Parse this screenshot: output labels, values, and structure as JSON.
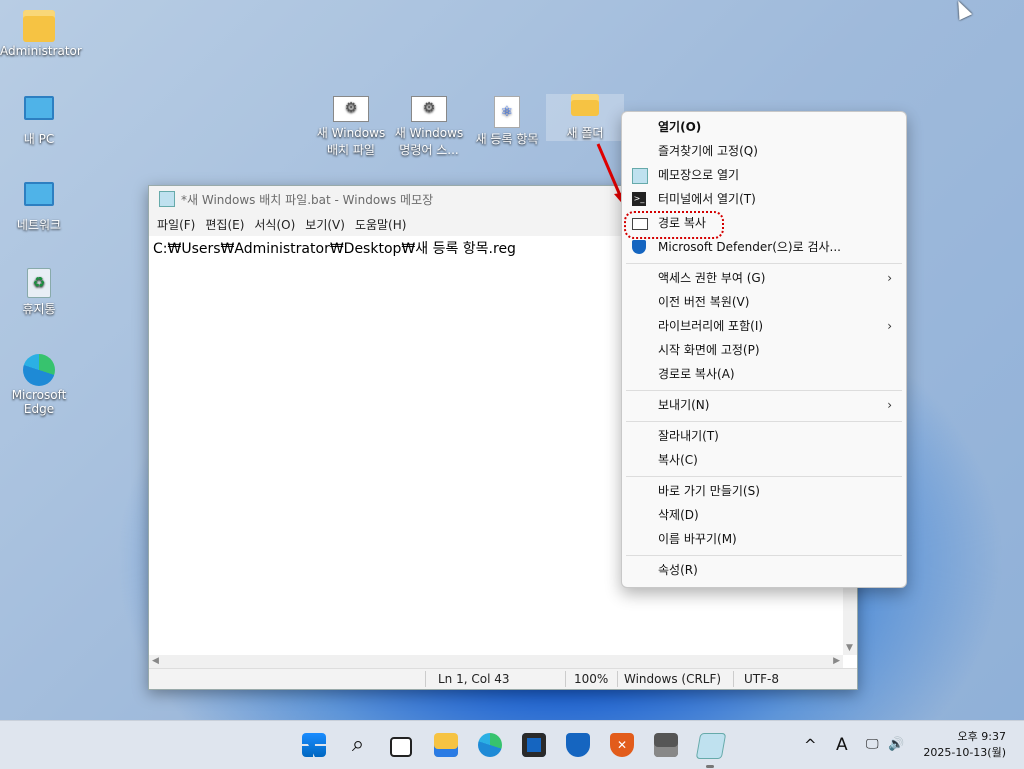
{
  "desktop": {
    "icons": [
      {
        "label": "Administrator",
        "icon": "folder-icon"
      },
      {
        "label": "내 PC",
        "icon": "pc-icon"
      },
      {
        "label": "네트워크",
        "icon": "network-icon"
      },
      {
        "label": "휴지통",
        "icon": "recycle-bin-icon"
      },
      {
        "label": "Microsoft Edge",
        "icon": "edge-icon"
      }
    ],
    "files": [
      {
        "label": "새 Windows 배치 파일",
        "icon": "batch-file-icon"
      },
      {
        "label": "새 Windows 명령어 스...",
        "icon": "cmd-file-icon"
      },
      {
        "label": "새 등록 항목",
        "icon": "reg-file-icon"
      },
      {
        "label": "새 폴더",
        "icon": "folder-icon"
      }
    ]
  },
  "notepad": {
    "title": "*새 Windows 배치 파일.bat - Windows 메모장",
    "menu": [
      "파일(F)",
      "편집(E)",
      "서식(O)",
      "보기(V)",
      "도움말(H)"
    ],
    "content": "C:₩Users₩Administrator₩Desktop₩새 등록 항목.reg",
    "status": {
      "position": "Ln 1, Col 43",
      "zoom": "100%",
      "line_ending": "Windows (CRLF)",
      "encoding": "UTF-8"
    }
  },
  "context_menu": {
    "groups": [
      [
        {
          "label": "열기(O)",
          "bold": true
        },
        {
          "label": "즐겨찾기에 고정(Q)"
        },
        {
          "label": "메모장으로 열기",
          "icon": "notepad-icon"
        },
        {
          "label": "터미널에서 열기(T)",
          "icon": "terminal-icon"
        },
        {
          "label": "경로 복사",
          "icon": "copy-path-icon",
          "highlighted": true
        },
        {
          "label": "Microsoft Defender(으)로 검사...",
          "icon": "defender-shield-icon"
        }
      ],
      [
        {
          "label": "액세스 권한 부여 (G)",
          "submenu": true
        },
        {
          "label": "이전 버전 복원(V)"
        },
        {
          "label": "라이브러리에 포함(I)",
          "submenu": true
        },
        {
          "label": "시작 화면에 고정(P)"
        },
        {
          "label": "경로로 복사(A)"
        }
      ],
      [
        {
          "label": "보내기(N)",
          "submenu": true
        }
      ],
      [
        {
          "label": "잘라내기(T)"
        },
        {
          "label": "복사(C)"
        }
      ],
      [
        {
          "label": "바로 가기 만들기(S)"
        },
        {
          "label": "삭제(D)"
        },
        {
          "label": "이름 바꾸기(M)"
        }
      ],
      [
        {
          "label": "속성(R)"
        }
      ]
    ],
    "submenu_glyph": "›"
  },
  "taskbar": {
    "apps": [
      "start-icon",
      "search-icon",
      "task-view-icon",
      "file-explorer-icon",
      "edge-icon",
      "store-icon",
      "defender-icon",
      "antivirus-icon",
      "printer-icon",
      "notepad-icon"
    ],
    "tray": {
      "chevron": "^",
      "ime": "A",
      "clock_time": "오후 9:37",
      "clock_date": "2025-10-13(월)"
    }
  },
  "colors": {
    "accent": "#0067c0",
    "highlight_border": "#d40000"
  }
}
